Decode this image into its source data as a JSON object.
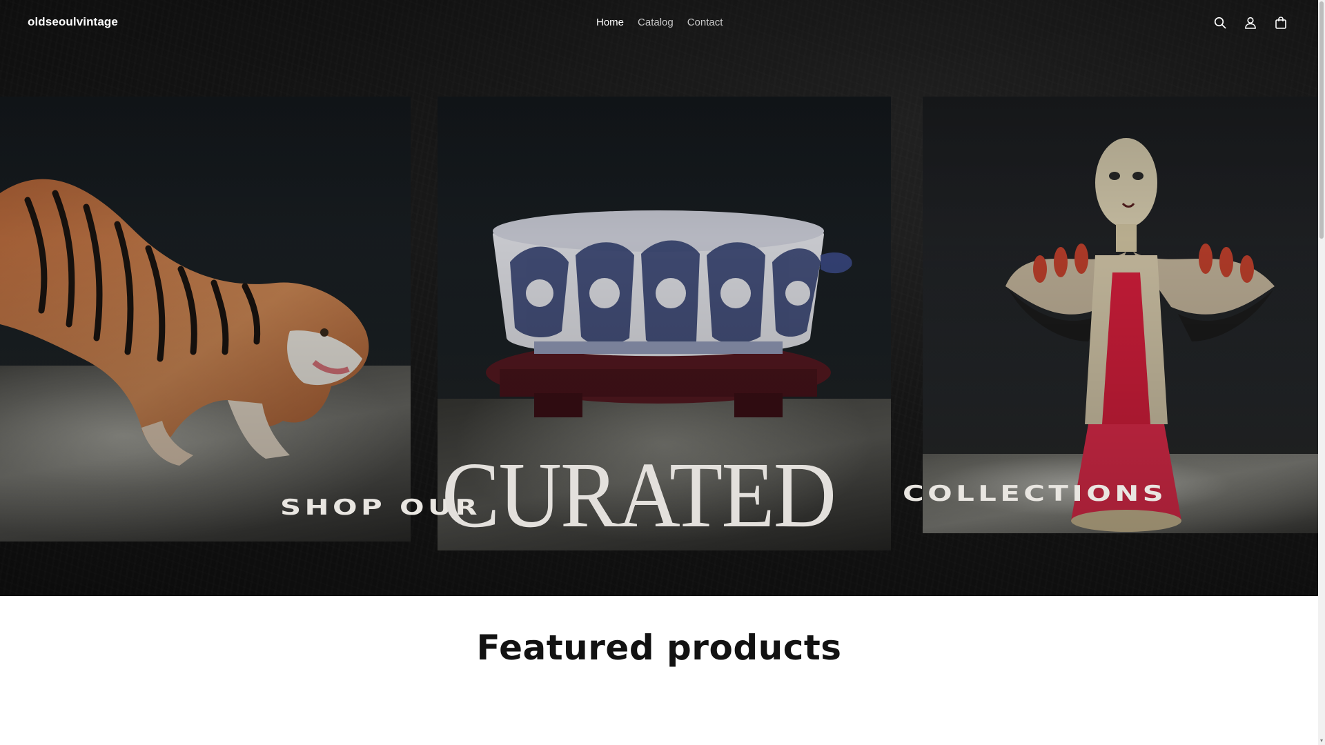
{
  "header": {
    "logo": "oldseoulvintage",
    "nav": [
      {
        "label": "Home",
        "active": true
      },
      {
        "label": "Catalog",
        "active": false
      },
      {
        "label": "Contact",
        "active": false
      }
    ],
    "icons": [
      "search-icon",
      "account-icon",
      "cart-icon"
    ]
  },
  "hero": {
    "word_1": "SHOP OUR",
    "word_2": "CURATED",
    "word_3": "COLLECTIONS",
    "panels": [
      "tiger-figurine",
      "blue-white-porcelain-bowl",
      "painted-angel-figure"
    ]
  },
  "featured": {
    "title": "Featured products"
  },
  "colors": {
    "hero_bg": "#1b1b1b",
    "text_light": "#ffffff",
    "heading_dark": "#121212"
  }
}
